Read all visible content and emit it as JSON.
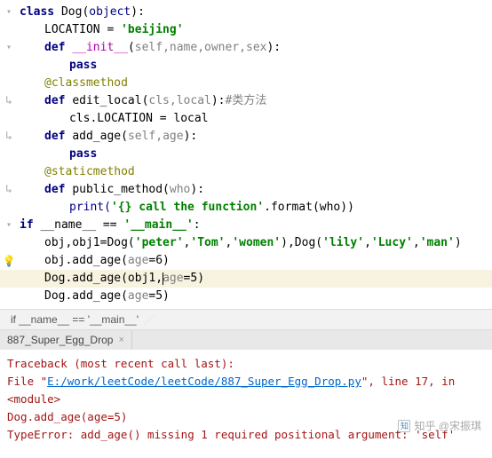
{
  "code": {
    "l1": {
      "kw_class": "class",
      "name": " Dog(",
      "obj": "object",
      "close": "):"
    },
    "l2": {
      "const": "LOCATION = ",
      "val": "'beijing'"
    },
    "l3": {
      "kw_def": "def ",
      "name": "__init__",
      "open": "(",
      "p": "self,name,owner,sex",
      "close": "):"
    },
    "l4": {
      "kw": "pass"
    },
    "l5": {
      "dec": "@classmethod"
    },
    "l6": {
      "kw_def": "def ",
      "name": "edit_local(",
      "p": "cls,local",
      "close": "):",
      "com": "#类方法"
    },
    "l7": {
      "txt": "cls.LOCATION = local"
    },
    "l8": {
      "kw_def": "def ",
      "name": "add_age(",
      "p": "self,age",
      "close": "):"
    },
    "l9": {
      "kw": "pass"
    },
    "l10": {
      "dec": "@staticmethod"
    },
    "l11": {
      "kw_def": "def ",
      "name": "public_method(",
      "p": "who",
      "close": "):"
    },
    "l12": {
      "fn": "print(",
      "str": "'{} call the function'",
      "rest": ".format(who))"
    },
    "l13": {
      "kw_if": "if ",
      "name": "__name__ == ",
      "str": "'__main__'",
      "close": ":"
    },
    "l14": {
      "a": "obj,obj1=Dog(",
      "s1": "'peter'",
      "c1": ",",
      "s2": "'Tom'",
      "c2": ",",
      "s3": "'women'",
      "m": "),Dog(",
      "s4": "'lily'",
      "c3": ",",
      "s5": "'Lucy'",
      "c4": ",",
      "s6": "'man'",
      "close": ")"
    },
    "l15": {
      "a": "obj.add_age(",
      "p": "age",
      "b": "=6)"
    },
    "l16": {
      "a": "Dog.add_age(obj1,",
      "p": "age",
      "b": "=5)"
    },
    "l17": {
      "a": "Dog.add_age(",
      "p": "age",
      "b": "=5)"
    }
  },
  "breadcrumbs": {
    "c1": "if __name__ == '__main__'"
  },
  "tab": {
    "name": "887_Super_Egg_Drop",
    "close": "×"
  },
  "console": {
    "tb": "Traceback (most recent call last):",
    "file_pre": "  File \"",
    "file_link": "E:/work/leetCode/leetCode/887_Super_Egg_Drop.py",
    "file_post": "\", line 17, in <module>",
    "frame": "    Dog.add_age(age=5)",
    "err": "TypeError: add_age() missing 1 required positional argument: 'self'"
  },
  "watermark": "知乎 @宋振琪"
}
